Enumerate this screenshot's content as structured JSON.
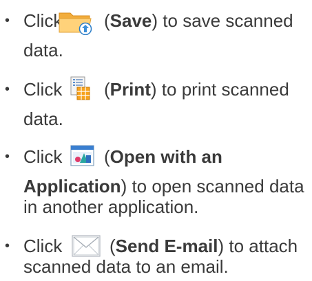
{
  "items": [
    {
      "lead": "Click",
      "icon": "folder-upload-icon",
      "paren_open": "(",
      "action": "Save",
      "rest1": ") to save scanned",
      "line2": "data."
    },
    {
      "lead": "Click",
      "icon": "print-icon",
      "paren_open": "(",
      "action": "Print",
      "rest1": ") to print scanned",
      "line2": "data."
    },
    {
      "lead": "Click",
      "icon": "application-window-icon",
      "paren_open": "(",
      "action_part1": "Open with an",
      "action_part2": "Application",
      "rest2": ") to open scanned data",
      "line3": "in another application."
    },
    {
      "lead": "Click",
      "icon": "envelope-icon",
      "paren_open": "(",
      "action": "Send E-mail",
      "rest1": ") to attach",
      "line2": "scanned data to an email."
    }
  ],
  "bullet_char": "•",
  "colors": {
    "text": "#3a3a3a",
    "folder": "#f6b94a",
    "upload_arrow": "#3b8fd9"
  }
}
